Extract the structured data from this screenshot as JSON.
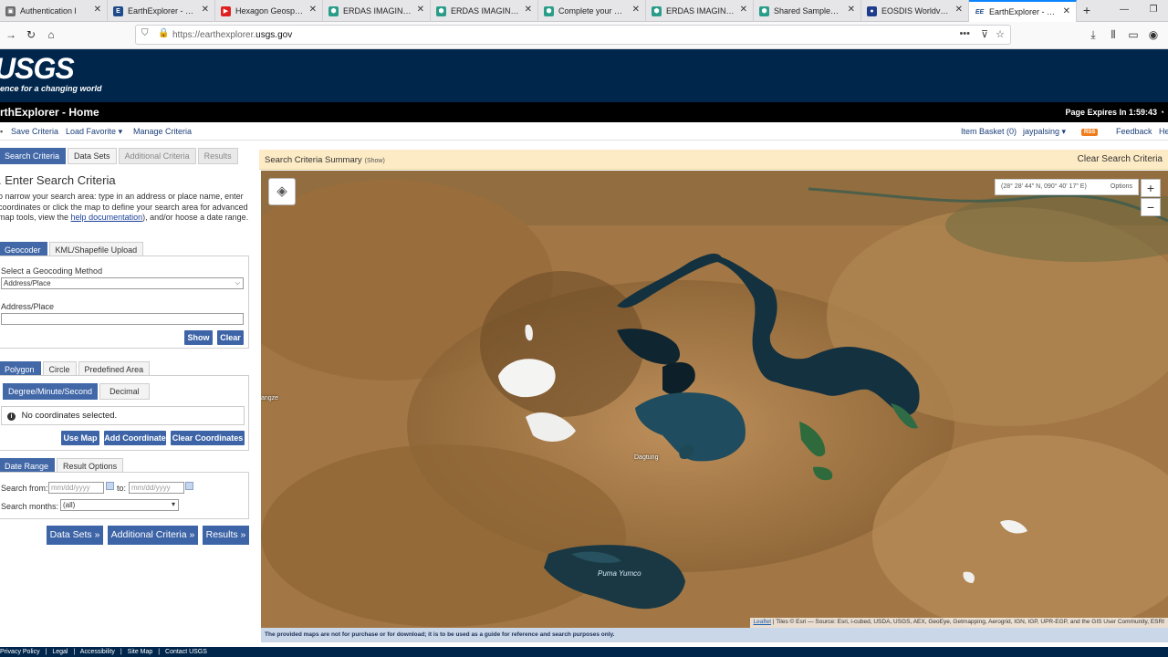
{
  "browser": {
    "tabs": [
      {
        "label": "Authentication l",
        "icon": "auth-icon",
        "color": "#6c6c6c"
      },
      {
        "label": "EarthExplorer - Sessi",
        "icon": "ee-icon",
        "color": "#1f4b8a"
      },
      {
        "label": "Hexagon Geospatial",
        "icon": "youtube-icon",
        "color": "#e02020"
      },
      {
        "label": "ERDAS IMAGINE: W",
        "icon": "hexagon-icon",
        "color": "#2a9c8a"
      },
      {
        "label": "ERDAS IMAGINE: W",
        "icon": "hexagon-icon",
        "color": "#2a9c8a"
      },
      {
        "label": "Complete your Profi",
        "icon": "hexagon-icon",
        "color": "#2a9c8a"
      },
      {
        "label": "ERDAS IMAGINE - H",
        "icon": "hexagon-icon",
        "color": "#2a9c8a"
      },
      {
        "label": "Shared Samples - He",
        "icon": "hexagon-icon",
        "color": "#2a9c8a"
      },
      {
        "label": "EOSDIS Worldview",
        "icon": "nasa-icon",
        "color": "#1d3c8c"
      },
      {
        "label": "EarthExplorer - Home",
        "icon": "ee-icon",
        "color": "#1f4b8a",
        "active": true
      }
    ],
    "url_prefix": "https://earthexplorer.",
    "url_domain": "usgs.gov"
  },
  "header": {
    "logo": "USGS",
    "tagline": "ence for a changing world",
    "app_title": "rthExplorer - Home",
    "page_expires": "Page Expires In 1:59:43"
  },
  "menubar": {
    "left": [
      "Save Criteria",
      "Load Favorite",
      "Manage Criteria"
    ],
    "item_basket": "Item Basket (0)",
    "user": "jaypalsing",
    "rss": "RSS",
    "feedback": "Feedback",
    "help": "He"
  },
  "left": {
    "tabs": [
      "Search Criteria",
      "Data Sets",
      "Additional Criteria",
      "Results"
    ],
    "title": ". Enter Search Criteria",
    "desc_before": "o narrow your search area: type in an address or place name, enter coordinates or click the map to define your search area for advanced map tools, view the ",
    "desc_link": "help documentation",
    "desc_after": "), and/or hoose a date range.",
    "geo_tabs": [
      "Geocoder",
      "KML/Shapefile Upload"
    ],
    "method_label": "Select a Geocoding Method",
    "method_value": "Address/Place",
    "address_label": "Address/Place",
    "address_value": "",
    "show": "Show",
    "clear": "Clear",
    "shape_tabs": [
      "Polygon",
      "Circle",
      "Predefined Area"
    ],
    "format_tabs": [
      "Degree/Minute/Second",
      "Decimal"
    ],
    "no_coords": "No coordinates selected.",
    "use_map": "Use Map",
    "add_coord": "Add Coordinate",
    "clear_coords": "Clear Coordinates",
    "date_tabs": [
      "Date Range",
      "Result Options"
    ],
    "search_from": "Search from:",
    "date_placeholder": "mm/dd/yyyy",
    "to": "to:",
    "search_months": "Search months:",
    "months_value": "(all)",
    "next_buttons": [
      "Data Sets »",
      "Additional Criteria »",
      "Results »"
    ]
  },
  "map": {
    "summary_title": "Search Criteria Summary",
    "summary_show": "(Show)",
    "clear_search": "Clear Search Criteria",
    "coords": "(28° 28' 44\" N, 090° 40' 17\" E)",
    "options": "Options",
    "zoom_in": "+",
    "zoom_out": "−",
    "labels": {
      "yangze": "angze",
      "dagtung": "Dagtung",
      "lake": "Puma Yumco"
    },
    "attribution_link": "Leaflet",
    "attribution": " | Tiles © Esri — Source: Esri, i-cubed, USDA, USGS, AEX, GeoEye, Getmapping, Aerogrid, IGN, IGP, UPR-EGP, and the GIS User Community, ESRI",
    "disclaimer": "The provided maps are not for purchase or for download; it is to be used as a guide for reference and search purposes only."
  },
  "footer": [
    "Privacy Policy",
    "|",
    "Legal",
    "|",
    "Accessibility",
    "|",
    "Site Map",
    "|",
    "Contact USGS"
  ]
}
